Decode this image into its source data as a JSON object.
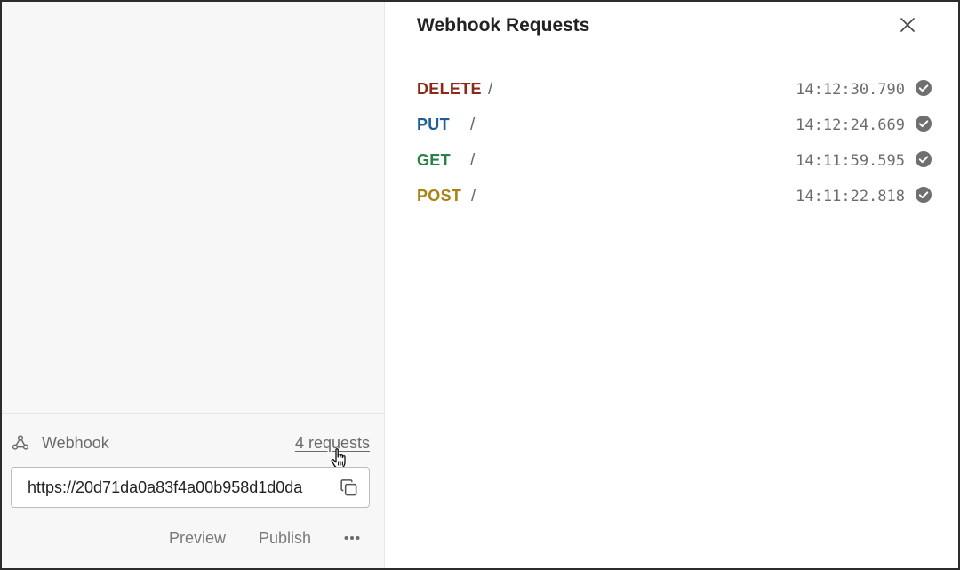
{
  "left_panel": {
    "webhook_label": "Webhook",
    "requests_link": "4 requests",
    "webhook_url": "https://20d71da0a83f4a00b958d1d0da",
    "actions": {
      "preview": "Preview",
      "publish": "Publish",
      "more_icon": "more-dots-icon"
    },
    "icons": {
      "webhook": "webhook-icon",
      "copy": "copy-icon",
      "cursor": "hand-pointer-cursor"
    }
  },
  "right_panel": {
    "title": "Webhook Requests",
    "close_icon": "close-icon",
    "requests": [
      {
        "method": "DELETE",
        "path": "/",
        "time": "14:12:30.790",
        "status": "success",
        "color": "#8a2a1b"
      },
      {
        "method": "PUT",
        "path": "/",
        "time": "14:12:24.669",
        "status": "success",
        "color": "#1d5e99"
      },
      {
        "method": "GET",
        "path": "/",
        "time": "14:11:59.595",
        "status": "success",
        "color": "#2a8047"
      },
      {
        "method": "POST",
        "path": "/",
        "time": "14:11:22.818",
        "status": "success",
        "color": "#a68415"
      }
    ]
  },
  "colors": {
    "status_check": "#6f6f6f",
    "left_background": "#f7f7f7"
  }
}
